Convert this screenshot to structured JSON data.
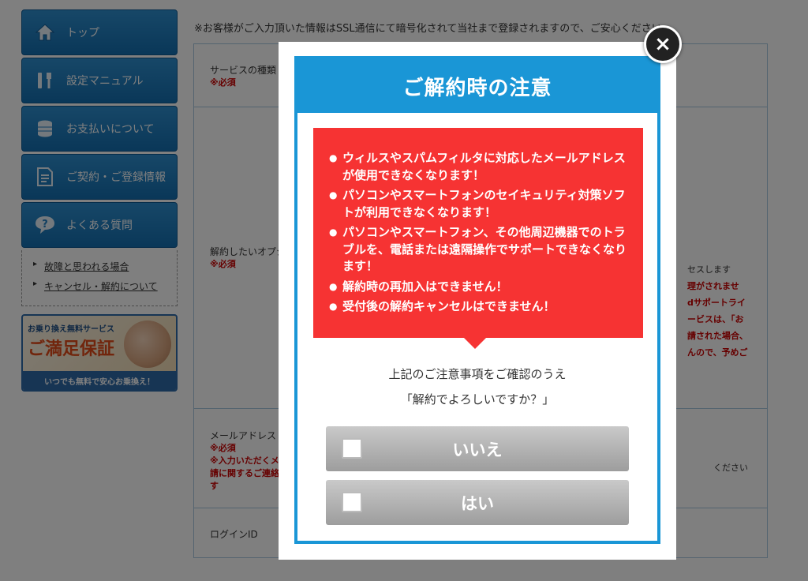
{
  "sidebar": {
    "items": [
      {
        "label": "トップ",
        "icon": "home-icon"
      },
      {
        "label": "設定マニュアル",
        "icon": "tools-icon"
      },
      {
        "label": "お支払いについて",
        "icon": "coins-icon"
      },
      {
        "label": "ご契約・ご登録情報",
        "icon": "document-icon"
      },
      {
        "label": "よくある質問",
        "icon": "question-icon"
      }
    ],
    "links": [
      "故障と思われる場合",
      "キャンセル・解約について"
    ],
    "banner": {
      "top": "お乗り換え無料サービス",
      "main": "ご満足保証",
      "bottom": "いつでも無料で安心お乗換え！"
    }
  },
  "form": {
    "notice": "※お客様がご入力頂いた情報はSSL通信にて暗号化されて当社まで登録されますので、ご安心ください。",
    "required": "※必須",
    "rows": {
      "service_type": "サービスの種類",
      "option": "解約したいオプシ",
      "email": "メールアドレス",
      "email_note1": "※入力いただくメ",
      "email_note2": "請に関するご連絡",
      "email_note3": "す",
      "login": "ログインID"
    },
    "right_texts": {
      "r1": "セスします",
      "r2": "理がされませ",
      "r3": "dサポートライ",
      "r4": "ービスは、「お",
      "r5": "請された場合、",
      "r6": "んので、予めご",
      "r7": "ください"
    }
  },
  "modal": {
    "title": "ご解約時の注意",
    "warnings": [
      "ウィルスやスパムフィルタに対応したメールアドレスが使用できなくなります！",
      "パソコンやスマートフォンのセイキュリティ対策ソフトが利用できなくなります！",
      "パソコンやスマートフォン、その他周辺機器でのトラブルを、電話または遠隔操作でサポートできなくなります！",
      "解約時の再加入はできません！",
      "受付後の解約キャンセルはできません！"
    ],
    "confirm_line1": "上記のご注意事項をご確認のうえ",
    "confirm_line2": "「解約でよろしいですか？」",
    "no_label": "いいえ",
    "yes_label": "はい",
    "close_glyph": "×"
  },
  "colors": {
    "accent": "#1a96d6",
    "warning": "#f63333",
    "sidebar": "#1f7ec2"
  }
}
